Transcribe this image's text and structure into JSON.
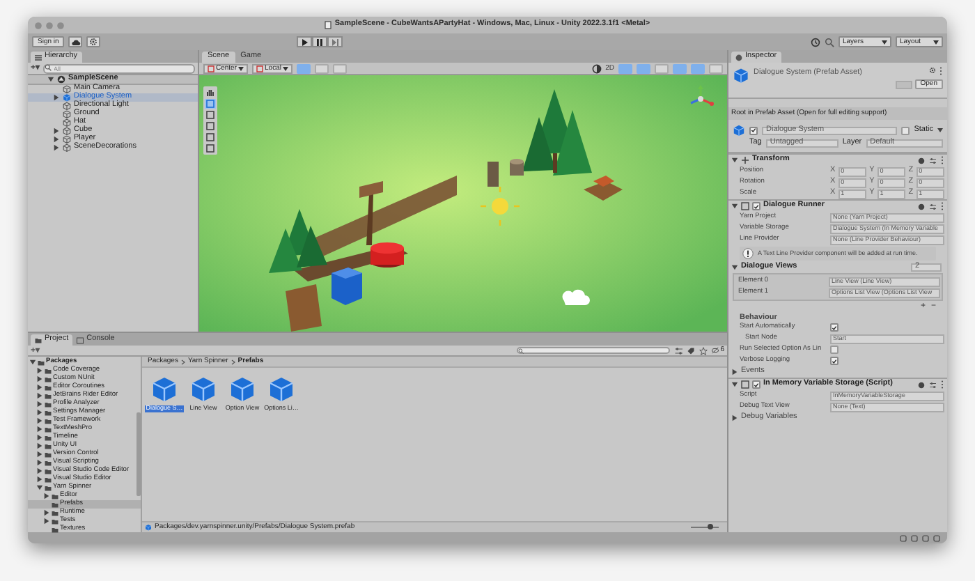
{
  "window": {
    "title": "SampleScene - CubeWantsAPartyHat - Windows, Mac, Linux - Unity 2022.3.1f1 <Metal>"
  },
  "toolbar": {
    "sign_in": "Sign in",
    "layers": "Layers",
    "layout": "Layout"
  },
  "hierarchy": {
    "title": "Hierarchy",
    "add_button": "+▾",
    "placeholder": "All",
    "scene": "SampleScene",
    "items": [
      {
        "label": "Main Camera",
        "kind": "object",
        "selected": false,
        "expandable": false
      },
      {
        "label": "Dialogue System",
        "kind": "prefab",
        "selected": true,
        "expandable": true,
        "expanded": false
      },
      {
        "label": "Directional Light",
        "kind": "object",
        "selected": false,
        "expandable": false
      },
      {
        "label": "Ground",
        "kind": "object",
        "selected": false,
        "expandable": false
      },
      {
        "label": "Hat",
        "kind": "object",
        "selected": false,
        "expandable": false
      },
      {
        "label": "Cube",
        "kind": "object",
        "selected": false,
        "expandable": true,
        "expanded": false
      },
      {
        "label": "Player",
        "kind": "object",
        "selected": false,
        "expandable": true,
        "expanded": false
      },
      {
        "label": "SceneDecorations",
        "kind": "object",
        "selected": false,
        "expandable": true,
        "expanded": false
      }
    ]
  },
  "scene_view": {
    "tabs": [
      {
        "label": "Scene",
        "selected": true
      },
      {
        "label": "Game",
        "selected": false
      }
    ],
    "pivot": "Center",
    "space": "Local",
    "mode_2d": "2D"
  },
  "inspector": {
    "title": "Inspector",
    "asset_name": "Dialogue System (Prefab Asset)",
    "open_button": "Open",
    "note": "Root in Prefab Asset (Open for full editing support)",
    "object": {
      "name": "Dialogue System",
      "active": true,
      "static": false,
      "static_label": "Static",
      "tag_label": "Tag",
      "tag": "Untagged",
      "layer_label": "Layer",
      "layer": "Default"
    },
    "transform": {
      "title": "Transform",
      "rows": [
        {
          "label": "Position",
          "values": [
            {
              "axis": "X",
              "value": "0"
            },
            {
              "axis": "Y",
              "value": "0"
            },
            {
              "axis": "Z",
              "value": "0"
            }
          ]
        },
        {
          "label": "Rotation",
          "values": [
            {
              "axis": "X",
              "value": "0"
            },
            {
              "axis": "Y",
              "value": "0"
            },
            {
              "axis": "Z",
              "value": "0"
            }
          ]
        },
        {
          "label": "Scale",
          "values": [
            {
              "axis": "X",
              "value": "1"
            },
            {
              "axis": "Y",
              "value": "1"
            },
            {
              "axis": "Z",
              "value": "1"
            }
          ]
        }
      ]
    },
    "dialogue_runner": {
      "title": "Dialogue Runner",
      "enabled": true,
      "fields": [
        {
          "label": "Yarn Project",
          "value": "None (Yarn Project)"
        },
        {
          "label": "Variable Storage",
          "value": "Dialogue System (In Memory Variable"
        },
        {
          "label": "Line Provider",
          "value": "None (Line Provider Behaviour)"
        }
      ],
      "info": "A Text Line Provider component will be added at run time.",
      "views_label": "Dialogue Views",
      "views_count": "2",
      "views": [
        {
          "label": "Element 0",
          "value": "Line View (Line View)"
        },
        {
          "label": "Element 1",
          "value": "Options List View (Options List View"
        }
      ],
      "add": "+",
      "remove": "−",
      "behaviour": "Behaviour",
      "options": [
        {
          "kind": "checkbox",
          "label": "Start Automatically",
          "checked": true
        },
        {
          "kind": "text",
          "label": "Start Node",
          "value": "Start"
        },
        {
          "kind": "checkbox",
          "label": "Run Selected Option As Lin",
          "checked": false
        },
        {
          "kind": "checkbox",
          "label": "Verbose Logging",
          "checked": true
        }
      ],
      "events": "Events"
    },
    "storage": {
      "title": "In Memory Variable Storage (Script)",
      "enabled": true,
      "fields": [
        {
          "label": "Script",
          "value": "InMemoryVariableStorage"
        },
        {
          "label": "Debug Text View",
          "value": "None (Text)"
        }
      ],
      "foldout": "Debug Variables"
    }
  },
  "project": {
    "tabs": [
      {
        "label": "Project",
        "selected": true
      },
      {
        "label": "Console",
        "selected": false
      }
    ],
    "add_button": "+▾",
    "hidden_count": "6",
    "tree": [
      {
        "label": "Packages",
        "expandable": true,
        "expanded": true,
        "selected": false,
        "children": [
          {
            "label": "Code Coverage",
            "expandable": true,
            "expanded": false,
            "selected": false
          },
          {
            "label": "Custom NUnit",
            "expandable": true,
            "expanded": false,
            "selected": false
          },
          {
            "label": "Editor Coroutines",
            "expandable": true,
            "expanded": false,
            "selected": false
          },
          {
            "label": "JetBrains Rider Editor",
            "expandable": true,
            "expanded": false,
            "selected": false
          },
          {
            "label": "Profile Analyzer",
            "expandable": true,
            "expanded": false,
            "selected": false
          },
          {
            "label": "Settings Manager",
            "expandable": true,
            "expanded": false,
            "selected": false
          },
          {
            "label": "Test Framework",
            "expandable": true,
            "expanded": false,
            "selected": false
          },
          {
            "label": "TextMeshPro",
            "expandable": true,
            "expanded": false,
            "selected": false
          },
          {
            "label": "Timeline",
            "expandable": true,
            "expanded": false,
            "selected": false
          },
          {
            "label": "Unity UI",
            "expandable": true,
            "expanded": false,
            "selected": false
          },
          {
            "label": "Version Control",
            "expandable": true,
            "expanded": false,
            "selected": false
          },
          {
            "label": "Visual Scripting",
            "expandable": true,
            "expanded": false,
            "selected": false
          },
          {
            "label": "Visual Studio Code Editor",
            "expandable": true,
            "expanded": false,
            "selected": false
          },
          {
            "label": "Visual Studio Editor",
            "expandable": true,
            "expanded": false,
            "selected": false
          },
          {
            "label": "Yarn Spinner",
            "expandable": true,
            "expanded": true,
            "selected": false,
            "children": [
              {
                "label": "Editor",
                "expandable": true,
                "expanded": false,
                "selected": false
              },
              {
                "label": "Prefabs",
                "expandable": false,
                "selected": true
              },
              {
                "label": "Runtime",
                "expandable": true,
                "expanded": false,
                "selected": false
              },
              {
                "label": "Tests",
                "expandable": true,
                "expanded": false,
                "selected": false
              },
              {
                "label": "Textures",
                "expandable": false,
                "selected": false
              }
            ]
          }
        ]
      }
    ],
    "breadcrumb": [
      "Packages",
      "Yarn Spinner",
      "Prefabs"
    ],
    "assets": [
      {
        "label": "Dialogue S…",
        "selected": true
      },
      {
        "label": "Line View",
        "selected": false
      },
      {
        "label": "Option View",
        "selected": false
      },
      {
        "label": "Options Li…",
        "selected": false
      }
    ],
    "path": "Packages/dev.yarnspinner.unity/Prefabs/Dialogue System.prefab",
    "icon_size": {
      "level": 0.7
    }
  }
}
